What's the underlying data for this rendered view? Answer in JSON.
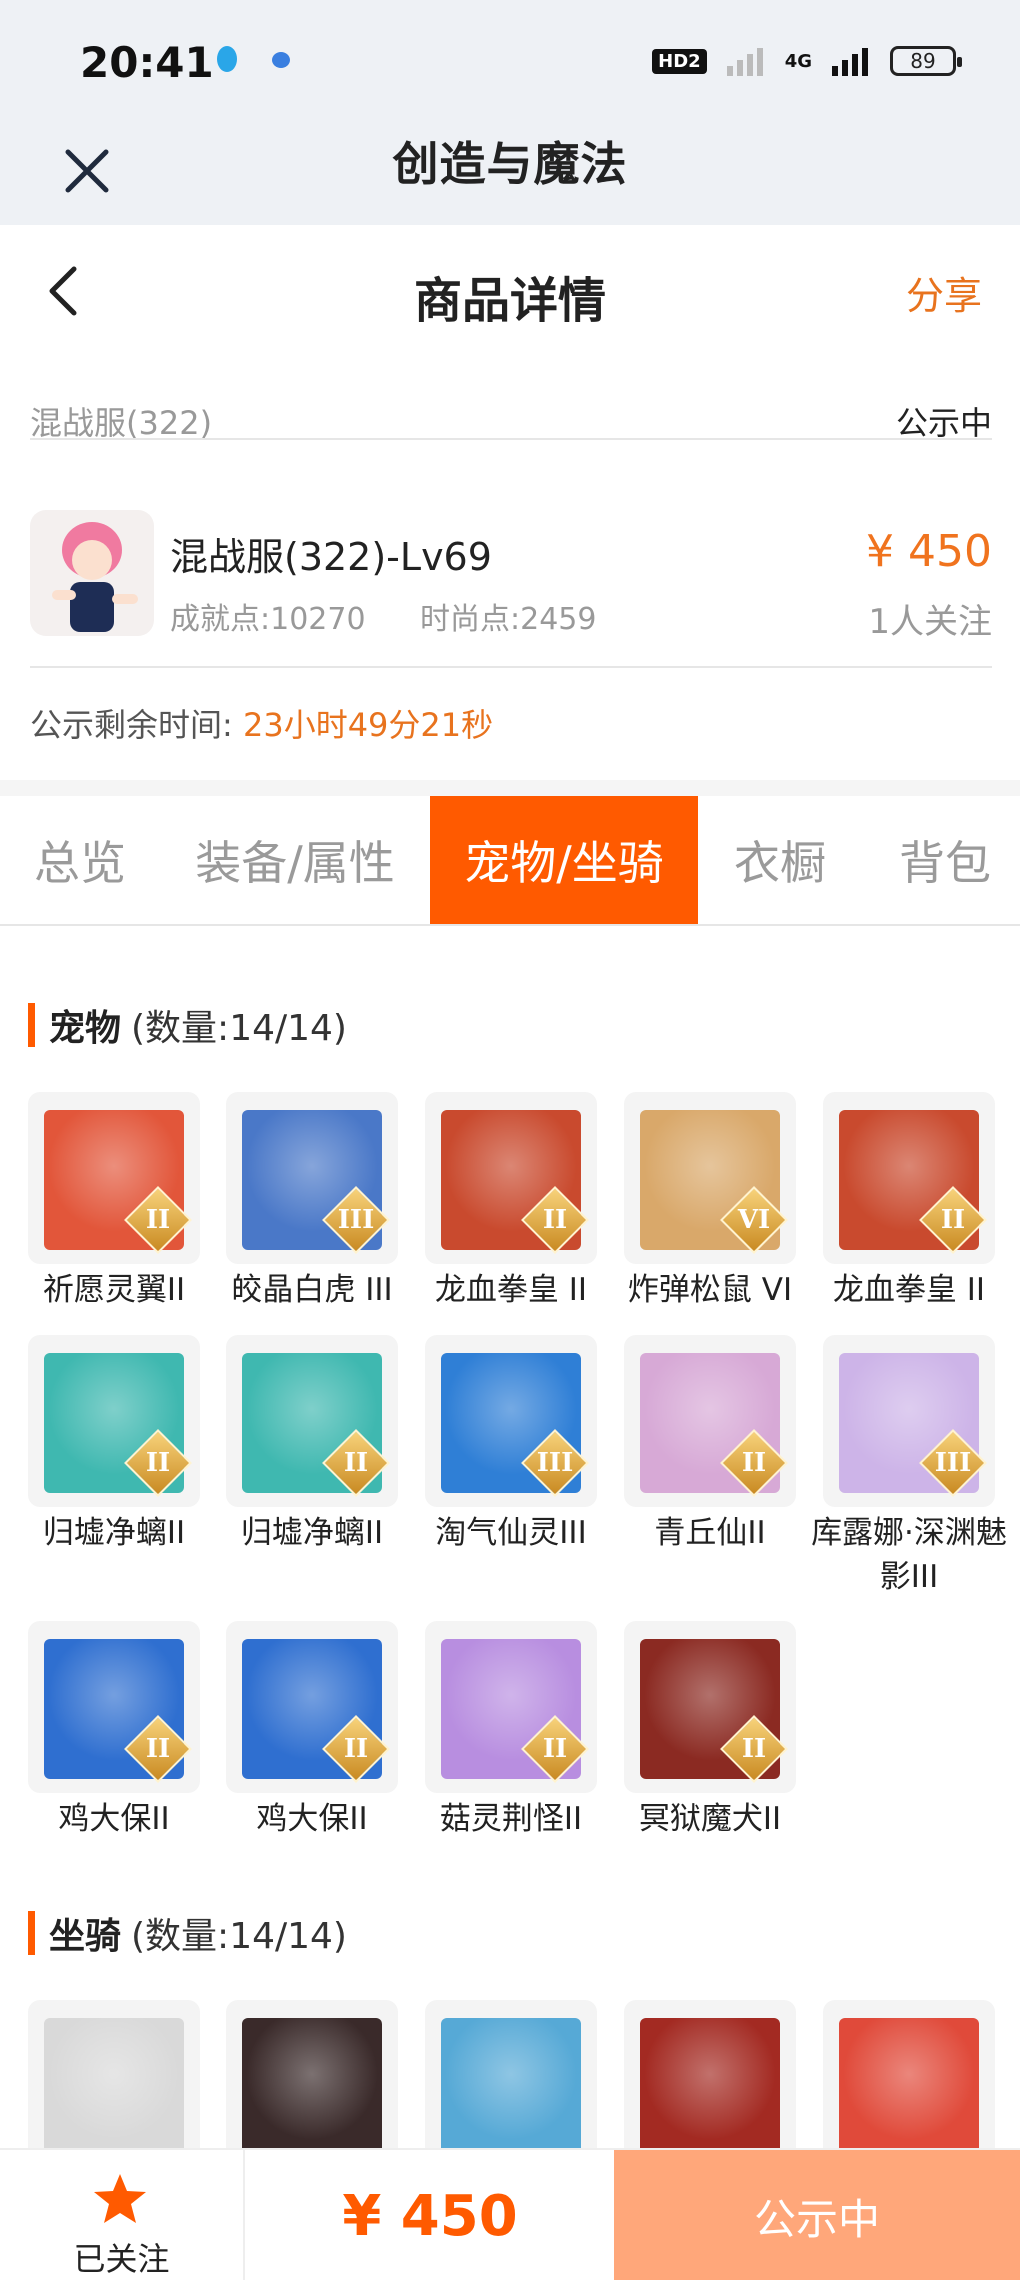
{
  "status_bar": {
    "time": "20:41",
    "hd_badge": "HD2",
    "network": "4G",
    "battery": "89"
  },
  "app_header": {
    "title": "创造与魔法",
    "close_icon": "close-icon"
  },
  "page_header": {
    "title": "商品详情",
    "share_label": "分享",
    "back_icon": "chevron-left-icon"
  },
  "server": {
    "name": "混战服(322)",
    "status": "公示中"
  },
  "role": {
    "name": "混战服(322)-Lv69",
    "achievement": "成就点:10270",
    "fashion": "时尚点:2459",
    "price": "¥ 450",
    "followers": "1人关注"
  },
  "countdown": {
    "label": "公示剩余时间:",
    "value": "23小时49分21秒"
  },
  "tabs": [
    {
      "label": "总览",
      "active": false
    },
    {
      "label": "装备/属性",
      "active": false
    },
    {
      "label": "宠物/坐骑",
      "active": true
    },
    {
      "label": "衣橱",
      "active": false
    },
    {
      "label": "背包",
      "active": false
    }
  ],
  "pets": {
    "title": "宠物",
    "count": "(数量:14/14)",
    "items": [
      {
        "label": "祈愿灵翼II",
        "grade": "II",
        "color": "#e2563a"
      },
      {
        "label": "皎晶白虎 III",
        "grade": "III",
        "color": "#4a78c8"
      },
      {
        "label": "龙血拳皇 II",
        "grade": "II",
        "color": "#c94a2e"
      },
      {
        "label": "炸弹松鼠 VI",
        "grade": "VI",
        "color": "#d9a86a"
      },
      {
        "label": "龙血拳皇 II",
        "grade": "II",
        "color": "#c94a2e"
      },
      {
        "label": "归墟净螭II",
        "grade": "II",
        "color": "#3fb8b0"
      },
      {
        "label": "归墟净螭II",
        "grade": "II",
        "color": "#3fb8b0"
      },
      {
        "label": "淘气仙灵III",
        "grade": "III",
        "color": "#2f7fd6"
      },
      {
        "label": "青丘仙II",
        "grade": "II",
        "color": "#d7a9d6"
      },
      {
        "label": "库露娜·深渊魅影III",
        "grade": "III",
        "color": "#cdb4e8"
      },
      {
        "label": "鸡大保II",
        "grade": "II",
        "color": "#2f6fd0"
      },
      {
        "label": "鸡大保II",
        "grade": "II",
        "color": "#2f6fd0"
      },
      {
        "label": "菇灵荆怪II",
        "grade": "II",
        "color": "#b88ee0"
      },
      {
        "label": "冥狱魔犬II",
        "grade": "II",
        "color": "#8b2a22"
      }
    ]
  },
  "mounts": {
    "title": "坐骑",
    "count": "(数量:14/14)",
    "items": [
      {
        "label": "",
        "color": "#d9d9d9"
      },
      {
        "label": "",
        "color": "#3a2a2a"
      },
      {
        "label": "",
        "color": "#56a9d6"
      },
      {
        "label": "",
        "color": "#a32a22"
      },
      {
        "label": "",
        "color": "#e04a3a"
      }
    ]
  },
  "bottom_bar": {
    "follow_label": "已关注",
    "price": "¥ 450",
    "status_label": "公示中"
  },
  "colors": {
    "accent": "#ff5a00",
    "price": "#f0731e",
    "status_button": "#ffa77a"
  }
}
